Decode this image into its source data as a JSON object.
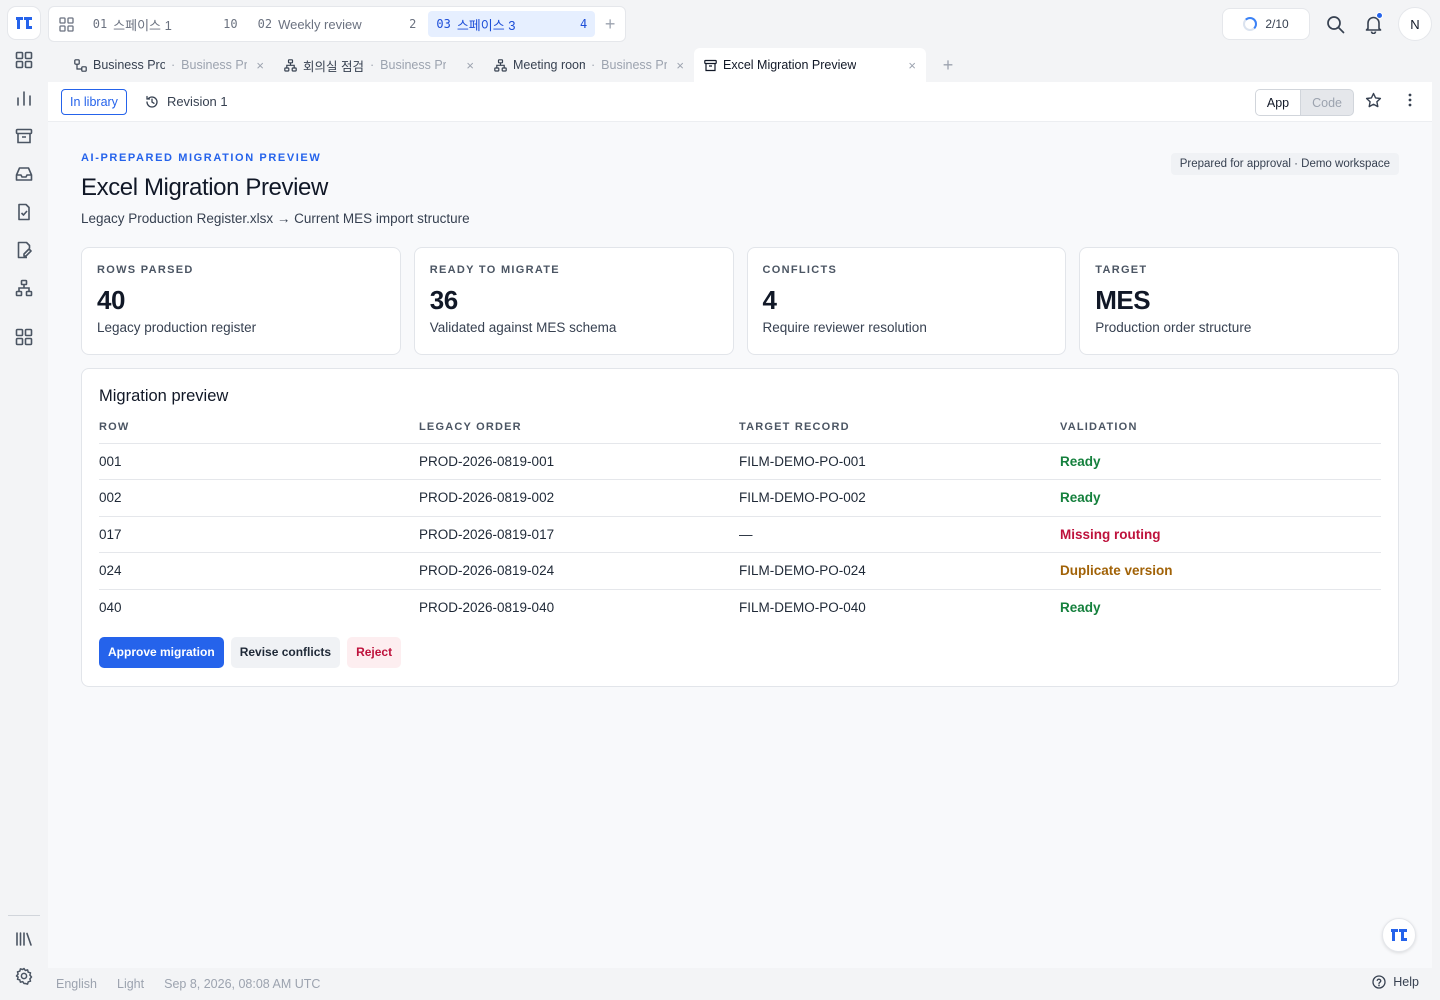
{
  "workspaces": [
    {
      "num": "01",
      "name": "스페이스 1",
      "count": "10",
      "active": false
    },
    {
      "num": "02",
      "name": "Weekly review",
      "count": "2",
      "active": false
    },
    {
      "num": "03",
      "name": "스페이스 3",
      "count": "4",
      "active": true
    }
  ],
  "header": {
    "usage": "2/10",
    "avatar_initial": "N"
  },
  "doc_tabs": [
    {
      "title": "Business Process",
      "context": "Business Process",
      "icon": "flow-icon"
    },
    {
      "title": "회의실 점검",
      "context": "Business Process",
      "icon": "hierarchy-icon"
    },
    {
      "title": "Meeting room",
      "context": "Business Process",
      "icon": "hierarchy-icon"
    },
    {
      "title": "Excel Migration Preview",
      "context": "",
      "icon": "archive-icon",
      "active": true
    }
  ],
  "toolbar": {
    "library_badge": "In library",
    "revision": "Revision 1",
    "mode_app": "App",
    "mode_code": "Code"
  },
  "page": {
    "eyebrow": "AI-PREPARED MIGRATION PREVIEW",
    "title": "Excel Migration Preview",
    "subtitle": "Legacy Production Register.xlsx → Current MES import structure",
    "prepared": "Prepared for approval · Demo workspace"
  },
  "cards": [
    {
      "label": "ROWS PARSED",
      "value": "40",
      "desc": "Legacy production register"
    },
    {
      "label": "READY TO MIGRATE",
      "value": "36",
      "desc": "Validated against MES schema"
    },
    {
      "label": "CONFLICTS",
      "value": "4",
      "desc": "Require reviewer resolution"
    },
    {
      "label": "TARGET",
      "value": "MES",
      "desc": "Production order structure"
    }
  ],
  "table": {
    "title": "Migration preview",
    "headers": [
      "ROW",
      "LEGACY ORDER",
      "TARGET RECORD",
      "VALIDATION"
    ],
    "rows": [
      {
        "row": "001",
        "legacy": "PROD-2026-0819-001",
        "target": "FILM-DEMO-PO-001",
        "status": "Ready",
        "status_color": "#15803d"
      },
      {
        "row": "002",
        "legacy": "PROD-2026-0819-002",
        "target": "FILM-DEMO-PO-002",
        "status": "Ready",
        "status_color": "#15803d"
      },
      {
        "row": "017",
        "legacy": "PROD-2026-0819-017",
        "target": "—",
        "status": "Missing routing",
        "status_color": "#be123c"
      },
      {
        "row": "024",
        "legacy": "PROD-2026-0819-024",
        "target": "FILM-DEMO-PO-024",
        "status": "Duplicate version",
        "status_color": "#a16207"
      },
      {
        "row": "040",
        "legacy": "PROD-2026-0819-040",
        "target": "FILM-DEMO-PO-040",
        "status": "Ready",
        "status_color": "#15803d"
      }
    ]
  },
  "actions": {
    "approve": "Approve migration",
    "revise": "Revise conflicts",
    "reject": "Reject"
  },
  "footer": {
    "language": "English",
    "theme": "Light",
    "datetime": "Sep 8, 2026, 08:08 AM UTC",
    "help": "Help"
  },
  "colors": {
    "accent": "#2563eb"
  }
}
